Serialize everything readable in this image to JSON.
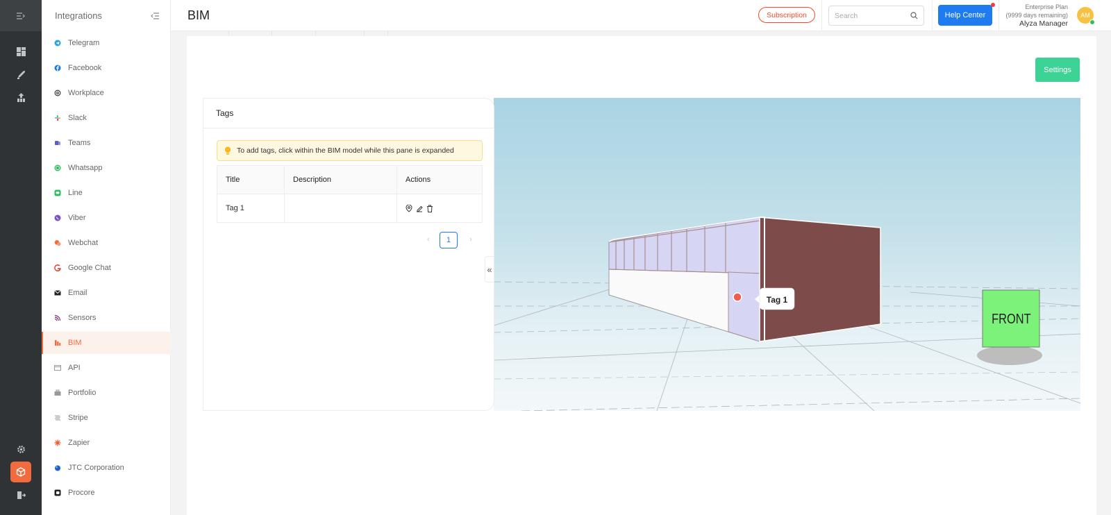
{
  "colors": {
    "accent": "#f26a3d",
    "primary": "#1e7bf0",
    "success": "#3cd394",
    "danger": "#ef4a2c",
    "rail": "#2f3336"
  },
  "rail": {
    "icons": [
      "collapse-menu-icon",
      "dashboard-icon",
      "rocket-icon",
      "analytics-icon",
      "settings-icon",
      "integrations-cube-icon",
      "logout-icon"
    ]
  },
  "sidenav": {
    "title": "Integrations",
    "items": [
      {
        "label": "Telegram",
        "icon": "telegram-icon",
        "color": "#2aa3df"
      },
      {
        "label": "Facebook",
        "icon": "facebook-icon",
        "color": "#1d7ad8"
      },
      {
        "label": "Workplace",
        "icon": "workplace-icon",
        "color": "#444"
      },
      {
        "label": "Slack",
        "icon": "slack-icon",
        "color": "#e01e5a"
      },
      {
        "label": "Teams",
        "icon": "teams-icon",
        "color": "#5a5fc7"
      },
      {
        "label": "Whatsapp",
        "icon": "whatsapp-icon",
        "color": "#2dbe5f"
      },
      {
        "label": "Line",
        "icon": "line-icon",
        "color": "#1fc35a"
      },
      {
        "label": "Viber",
        "icon": "viber-icon",
        "color": "#7b52c6"
      },
      {
        "label": "Webchat",
        "icon": "webchat-icon",
        "color": "#f26a3d"
      },
      {
        "label": "Google Chat",
        "icon": "google-icon",
        "color": "#ea4335"
      },
      {
        "label": "Email",
        "icon": "email-icon",
        "color": "#222"
      },
      {
        "label": "Sensors",
        "icon": "sensors-icon",
        "color": "#7a2f7a"
      },
      {
        "label": "BIM",
        "icon": "bim-icon",
        "color": "#f26a3d"
      },
      {
        "label": "API",
        "icon": "api-icon",
        "color": "#999"
      },
      {
        "label": "Portfolio",
        "icon": "portfolio-icon",
        "color": "#999"
      },
      {
        "label": "Stripe",
        "icon": "stripe-icon",
        "color": "#999"
      },
      {
        "label": "Zapier",
        "icon": "zapier-icon",
        "color": "#f2572d"
      },
      {
        "label": "JTC Corporation",
        "icon": "jtc-icon",
        "color": "#1a5fc8"
      },
      {
        "label": "Procore",
        "icon": "procore-icon",
        "color": "#222"
      }
    ],
    "active": "BIM"
  },
  "header": {
    "title": "BIM",
    "subscription_label": "Subscription",
    "search_placeholder": "Search",
    "help_label": "Help Center",
    "plan_line1": "Enterprise Plan",
    "plan_line2": "(9999 days remaining)",
    "user_name": "Alyza Manager",
    "avatar_initials": "AM"
  },
  "main": {
    "settings_label": "Settings",
    "tags": {
      "title": "Tags",
      "alert": "To add tags, click within the BIM model while this pane is expanded",
      "columns": [
        "Title",
        "Description",
        "Actions"
      ],
      "rows": [
        {
          "title": "Tag 1",
          "description": ""
        }
      ],
      "page": "1",
      "prev": "‹",
      "next": "›"
    },
    "collapse_glyph": "«",
    "viewer": {
      "tag_label": "Tag 1",
      "cube_label": "FRONT"
    }
  }
}
